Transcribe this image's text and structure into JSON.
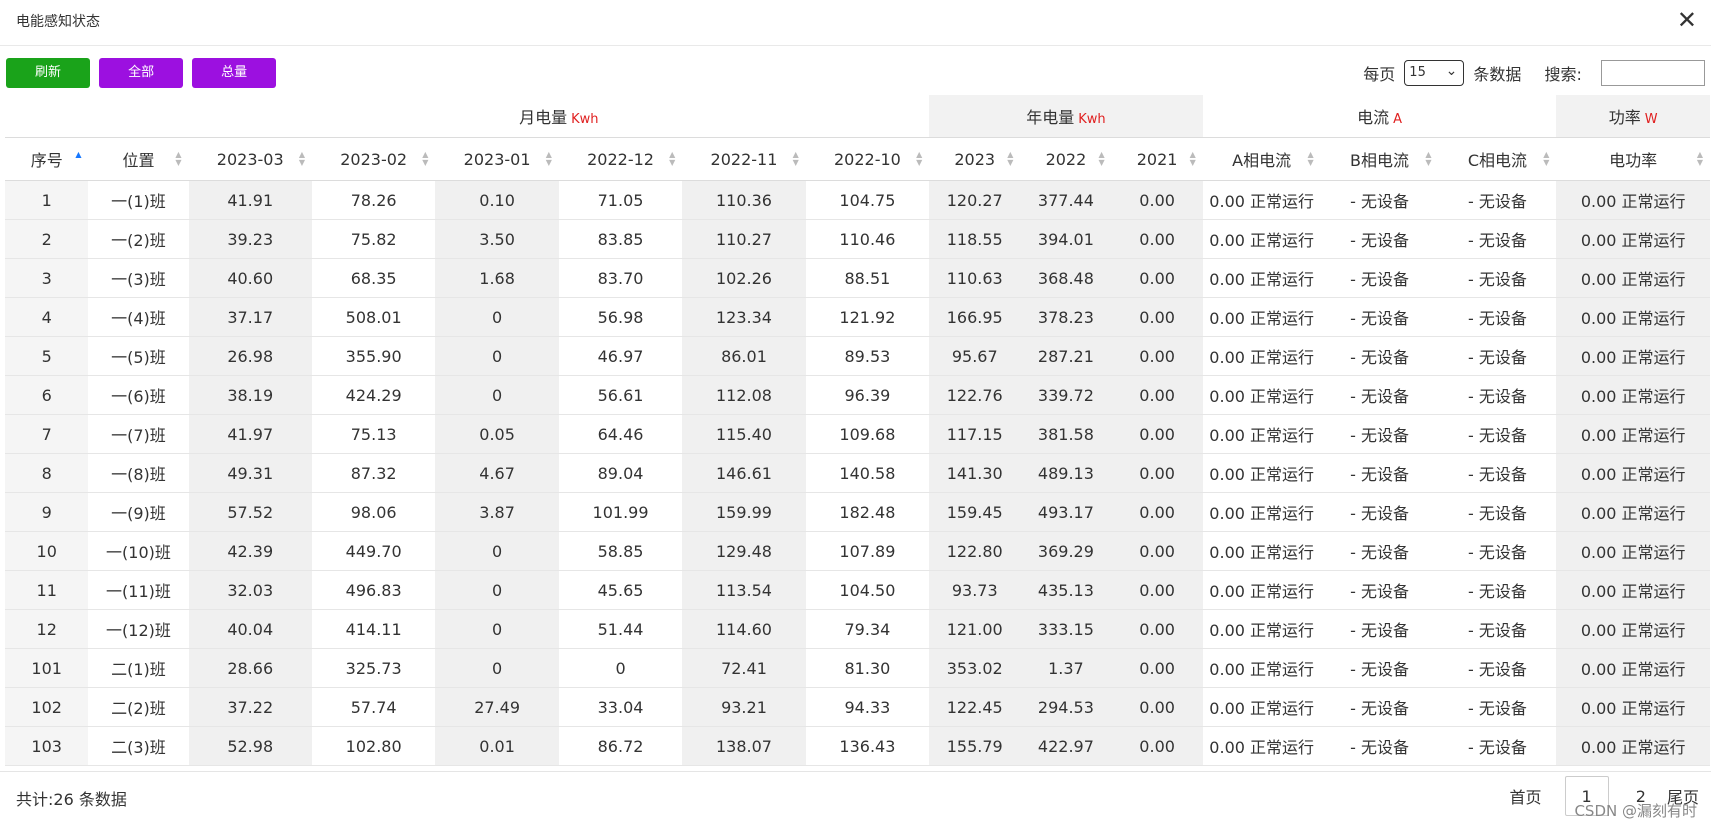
{
  "window": {
    "title": "电能感知状态",
    "close_glyph": "✕"
  },
  "toolbar": {
    "refresh": "刷新",
    "all": "全部",
    "total": "总量"
  },
  "pager_top": {
    "per_page_label": "每页",
    "per_page_value": "15",
    "records_label": "条数据",
    "search_label": "搜索:"
  },
  "table": {
    "groups": [
      {
        "label": "月电量",
        "unit": "Kwh",
        "span": 7,
        "shade": false,
        "first_blank": true
      },
      {
        "label": "年电量",
        "unit": "Kwh",
        "span": 3,
        "shade": true
      },
      {
        "label": "电流",
        "unit": "A",
        "span": 3,
        "shade": false
      },
      {
        "label": "功率",
        "unit": "W",
        "span": 1,
        "shade": true
      }
    ],
    "columns": [
      "序号",
      "位置",
      "2023-03",
      "2023-02",
      "2023-01",
      "2022-12",
      "2022-11",
      "2022-10",
      "2023",
      "2022",
      "2021",
      "A相电流",
      "B相电流",
      "C相电流",
      "电功率"
    ],
    "sorted_column": 0,
    "rows": [
      [
        "1",
        "一(1)班",
        "41.91",
        "78.26",
        "0.10",
        "71.05",
        "110.36",
        "104.75",
        "120.27",
        "377.44",
        "0.00",
        "0.00 正常运行",
        "- 无设备",
        "- 无设备",
        "0.00 正常运行"
      ],
      [
        "2",
        "一(2)班",
        "39.23",
        "75.82",
        "3.50",
        "83.85",
        "110.27",
        "110.46",
        "118.55",
        "394.01",
        "0.00",
        "0.00 正常运行",
        "- 无设备",
        "- 无设备",
        "0.00 正常运行"
      ],
      [
        "3",
        "一(3)班",
        "40.60",
        "68.35",
        "1.68",
        "83.70",
        "102.26",
        "88.51",
        "110.63",
        "368.48",
        "0.00",
        "0.00 正常运行",
        "- 无设备",
        "- 无设备",
        "0.00 正常运行"
      ],
      [
        "4",
        "一(4)班",
        "37.17",
        "508.01",
        "0",
        "56.98",
        "123.34",
        "121.92",
        "166.95",
        "378.23",
        "0.00",
        "0.00 正常运行",
        "- 无设备",
        "- 无设备",
        "0.00 正常运行"
      ],
      [
        "5",
        "一(5)班",
        "26.98",
        "355.90",
        "0",
        "46.97",
        "86.01",
        "89.53",
        "95.67",
        "287.21",
        "0.00",
        "0.00 正常运行",
        "- 无设备",
        "- 无设备",
        "0.00 正常运行"
      ],
      [
        "6",
        "一(6)班",
        "38.19",
        "424.29",
        "0",
        "56.61",
        "112.08",
        "96.39",
        "122.76",
        "339.72",
        "0.00",
        "0.00 正常运行",
        "- 无设备",
        "- 无设备",
        "0.00 正常运行"
      ],
      [
        "7",
        "一(7)班",
        "41.97",
        "75.13",
        "0.05",
        "64.46",
        "115.40",
        "109.68",
        "117.15",
        "381.58",
        "0.00",
        "0.00 正常运行",
        "- 无设备",
        "- 无设备",
        "0.00 正常运行"
      ],
      [
        "8",
        "一(8)班",
        "49.31",
        "87.32",
        "4.67",
        "89.04",
        "146.61",
        "140.58",
        "141.30",
        "489.13",
        "0.00",
        "0.00 正常运行",
        "- 无设备",
        "- 无设备",
        "0.00 正常运行"
      ],
      [
        "9",
        "一(9)班",
        "57.52",
        "98.06",
        "3.87",
        "101.99",
        "159.99",
        "182.48",
        "159.45",
        "493.17",
        "0.00",
        "0.00 正常运行",
        "- 无设备",
        "- 无设备",
        "0.00 正常运行"
      ],
      [
        "10",
        "一(10)班",
        "42.39",
        "449.70",
        "0",
        "58.85",
        "129.48",
        "107.89",
        "122.80",
        "369.29",
        "0.00",
        "0.00 正常运行",
        "- 无设备",
        "- 无设备",
        "0.00 正常运行"
      ],
      [
        "11",
        "一(11)班",
        "32.03",
        "496.83",
        "0",
        "45.65",
        "113.54",
        "104.50",
        "93.73",
        "435.13",
        "0.00",
        "0.00 正常运行",
        "- 无设备",
        "- 无设备",
        "0.00 正常运行"
      ],
      [
        "12",
        "一(12)班",
        "40.04",
        "414.11",
        "0",
        "51.44",
        "114.60",
        "79.34",
        "121.00",
        "333.15",
        "0.00",
        "0.00 正常运行",
        "- 无设备",
        "- 无设备",
        "0.00 正常运行"
      ],
      [
        "101",
        "二(1)班",
        "28.66",
        "325.73",
        "0",
        "0",
        "72.41",
        "81.30",
        "353.02",
        "1.37",
        "0.00",
        "0.00 正常运行",
        "- 无设备",
        "- 无设备",
        "0.00 正常运行"
      ],
      [
        "102",
        "二(2)班",
        "37.22",
        "57.74",
        "27.49",
        "33.04",
        "93.21",
        "94.33",
        "122.45",
        "294.53",
        "0.00",
        "0.00 正常运行",
        "- 无设备",
        "- 无设备",
        "0.00 正常运行"
      ],
      [
        "103",
        "二(3)班",
        "52.98",
        "102.80",
        "0.01",
        "86.72",
        "138.07",
        "136.43",
        "155.79",
        "422.97",
        "0.00",
        "0.00 正常运行",
        "- 无设备",
        "- 无设备",
        "0.00 正常运行"
      ]
    ]
  },
  "footer": {
    "total": "共计:26 条数据",
    "first": "首页",
    "pages": [
      "1",
      "2"
    ],
    "current_page": "1",
    "last": "尾页",
    "watermark": "CSDN @漏刻有时"
  }
}
